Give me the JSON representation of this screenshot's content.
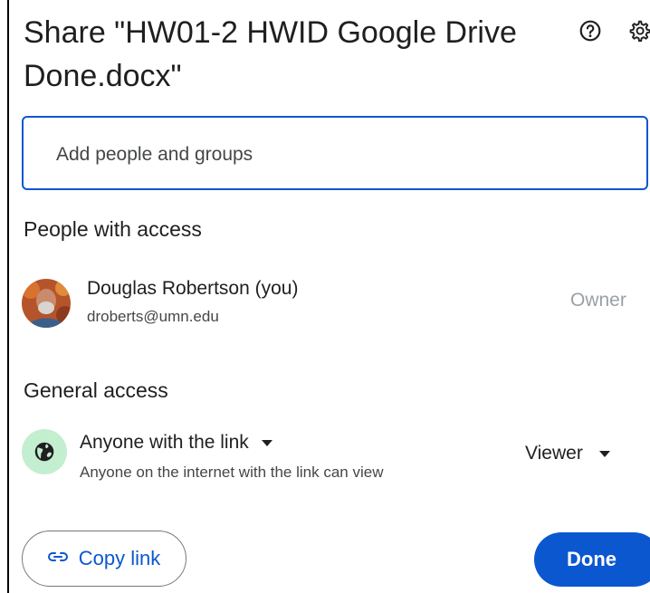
{
  "dialog": {
    "title": "Share \"HW01-2 HWID Google Drive Done.docx\""
  },
  "header_icons": {
    "help": "help-circle-icon",
    "settings": "gear-icon"
  },
  "add_people": {
    "placeholder": "Add people and groups",
    "value": ""
  },
  "people_section": {
    "heading": "People with access",
    "people": [
      {
        "name": "Douglas Robertson (you)",
        "email": "droberts@umn.edu",
        "role": "Owner"
      }
    ]
  },
  "general_access": {
    "heading": "General access",
    "icon": "globe-icon",
    "setting": "Anyone with the link",
    "description": "Anyone on the internet with the link can view",
    "role": "Viewer"
  },
  "footer": {
    "copy_link_label": "Copy link",
    "done_label": "Done"
  },
  "colors": {
    "accent": "#0b57d0",
    "globe_bg": "#c4eed0",
    "owner_text": "#9aa0a6"
  }
}
